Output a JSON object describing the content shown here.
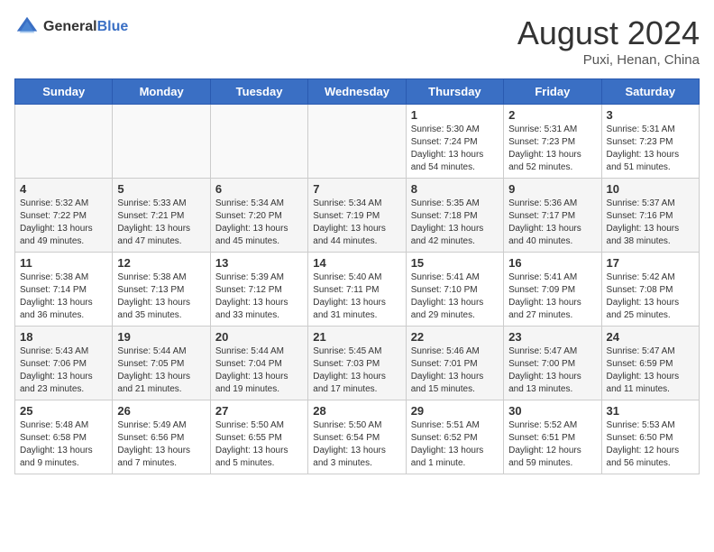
{
  "header": {
    "logo_general": "General",
    "logo_blue": "Blue",
    "month_year": "August 2024",
    "location": "Puxi, Henan, China"
  },
  "days_of_week": [
    "Sunday",
    "Monday",
    "Tuesday",
    "Wednesday",
    "Thursday",
    "Friday",
    "Saturday"
  ],
  "weeks": [
    {
      "alt": false,
      "days": [
        {
          "num": "",
          "info": "",
          "empty": true
        },
        {
          "num": "",
          "info": "",
          "empty": true
        },
        {
          "num": "",
          "info": "",
          "empty": true
        },
        {
          "num": "",
          "info": "",
          "empty": true
        },
        {
          "num": "1",
          "info": "Sunrise: 5:30 AM\nSunset: 7:24 PM\nDaylight: 13 hours\nand 54 minutes.",
          "empty": false
        },
        {
          "num": "2",
          "info": "Sunrise: 5:31 AM\nSunset: 7:23 PM\nDaylight: 13 hours\nand 52 minutes.",
          "empty": false
        },
        {
          "num": "3",
          "info": "Sunrise: 5:31 AM\nSunset: 7:23 PM\nDaylight: 13 hours\nand 51 minutes.",
          "empty": false
        }
      ]
    },
    {
      "alt": true,
      "days": [
        {
          "num": "4",
          "info": "Sunrise: 5:32 AM\nSunset: 7:22 PM\nDaylight: 13 hours\nand 49 minutes.",
          "empty": false
        },
        {
          "num": "5",
          "info": "Sunrise: 5:33 AM\nSunset: 7:21 PM\nDaylight: 13 hours\nand 47 minutes.",
          "empty": false
        },
        {
          "num": "6",
          "info": "Sunrise: 5:34 AM\nSunset: 7:20 PM\nDaylight: 13 hours\nand 45 minutes.",
          "empty": false
        },
        {
          "num": "7",
          "info": "Sunrise: 5:34 AM\nSunset: 7:19 PM\nDaylight: 13 hours\nand 44 minutes.",
          "empty": false
        },
        {
          "num": "8",
          "info": "Sunrise: 5:35 AM\nSunset: 7:18 PM\nDaylight: 13 hours\nand 42 minutes.",
          "empty": false
        },
        {
          "num": "9",
          "info": "Sunrise: 5:36 AM\nSunset: 7:17 PM\nDaylight: 13 hours\nand 40 minutes.",
          "empty": false
        },
        {
          "num": "10",
          "info": "Sunrise: 5:37 AM\nSunset: 7:16 PM\nDaylight: 13 hours\nand 38 minutes.",
          "empty": false
        }
      ]
    },
    {
      "alt": false,
      "days": [
        {
          "num": "11",
          "info": "Sunrise: 5:38 AM\nSunset: 7:14 PM\nDaylight: 13 hours\nand 36 minutes.",
          "empty": false
        },
        {
          "num": "12",
          "info": "Sunrise: 5:38 AM\nSunset: 7:13 PM\nDaylight: 13 hours\nand 35 minutes.",
          "empty": false
        },
        {
          "num": "13",
          "info": "Sunrise: 5:39 AM\nSunset: 7:12 PM\nDaylight: 13 hours\nand 33 minutes.",
          "empty": false
        },
        {
          "num": "14",
          "info": "Sunrise: 5:40 AM\nSunset: 7:11 PM\nDaylight: 13 hours\nand 31 minutes.",
          "empty": false
        },
        {
          "num": "15",
          "info": "Sunrise: 5:41 AM\nSunset: 7:10 PM\nDaylight: 13 hours\nand 29 minutes.",
          "empty": false
        },
        {
          "num": "16",
          "info": "Sunrise: 5:41 AM\nSunset: 7:09 PM\nDaylight: 13 hours\nand 27 minutes.",
          "empty": false
        },
        {
          "num": "17",
          "info": "Sunrise: 5:42 AM\nSunset: 7:08 PM\nDaylight: 13 hours\nand 25 minutes.",
          "empty": false
        }
      ]
    },
    {
      "alt": true,
      "days": [
        {
          "num": "18",
          "info": "Sunrise: 5:43 AM\nSunset: 7:06 PM\nDaylight: 13 hours\nand 23 minutes.",
          "empty": false
        },
        {
          "num": "19",
          "info": "Sunrise: 5:44 AM\nSunset: 7:05 PM\nDaylight: 13 hours\nand 21 minutes.",
          "empty": false
        },
        {
          "num": "20",
          "info": "Sunrise: 5:44 AM\nSunset: 7:04 PM\nDaylight: 13 hours\nand 19 minutes.",
          "empty": false
        },
        {
          "num": "21",
          "info": "Sunrise: 5:45 AM\nSunset: 7:03 PM\nDaylight: 13 hours\nand 17 minutes.",
          "empty": false
        },
        {
          "num": "22",
          "info": "Sunrise: 5:46 AM\nSunset: 7:01 PM\nDaylight: 13 hours\nand 15 minutes.",
          "empty": false
        },
        {
          "num": "23",
          "info": "Sunrise: 5:47 AM\nSunset: 7:00 PM\nDaylight: 13 hours\nand 13 minutes.",
          "empty": false
        },
        {
          "num": "24",
          "info": "Sunrise: 5:47 AM\nSunset: 6:59 PM\nDaylight: 13 hours\nand 11 minutes.",
          "empty": false
        }
      ]
    },
    {
      "alt": false,
      "days": [
        {
          "num": "25",
          "info": "Sunrise: 5:48 AM\nSunset: 6:58 PM\nDaylight: 13 hours\nand 9 minutes.",
          "empty": false
        },
        {
          "num": "26",
          "info": "Sunrise: 5:49 AM\nSunset: 6:56 PM\nDaylight: 13 hours\nand 7 minutes.",
          "empty": false
        },
        {
          "num": "27",
          "info": "Sunrise: 5:50 AM\nSunset: 6:55 PM\nDaylight: 13 hours\nand 5 minutes.",
          "empty": false
        },
        {
          "num": "28",
          "info": "Sunrise: 5:50 AM\nSunset: 6:54 PM\nDaylight: 13 hours\nand 3 minutes.",
          "empty": false
        },
        {
          "num": "29",
          "info": "Sunrise: 5:51 AM\nSunset: 6:52 PM\nDaylight: 13 hours\nand 1 minute.",
          "empty": false
        },
        {
          "num": "30",
          "info": "Sunrise: 5:52 AM\nSunset: 6:51 PM\nDaylight: 12 hours\nand 59 minutes.",
          "empty": false
        },
        {
          "num": "31",
          "info": "Sunrise: 5:53 AM\nSunset: 6:50 PM\nDaylight: 12 hours\nand 56 minutes.",
          "empty": false
        }
      ]
    }
  ]
}
